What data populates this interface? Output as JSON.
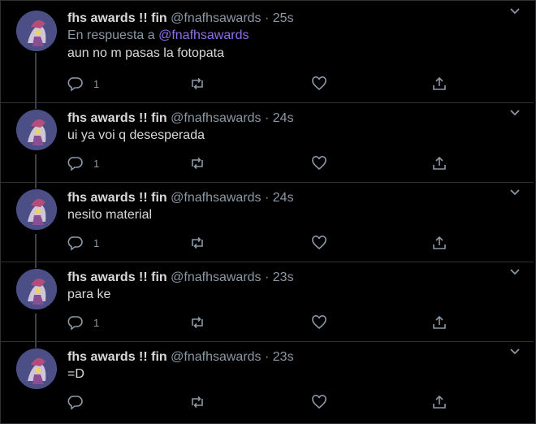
{
  "colors": {
    "background": "#000000",
    "text": "#d9d9d9",
    "muted": "#8b98a5",
    "mention": "#8d6fe8",
    "avatar": "#4b4f86"
  },
  "tweets": [
    {
      "name": "fhs awards !! fin",
      "handle": "@fnafhsawards",
      "dot": "·",
      "time": "25s",
      "reply_prefix": "En respuesta a",
      "reply_mention": "@fnafhsawards",
      "text": "aun no m pasas la fotopata",
      "reply_count": "1"
    },
    {
      "name": "fhs awards !! fin",
      "handle": "@fnafhsawards",
      "dot": "·",
      "time": "24s",
      "text": "ui ya voi q desesperada",
      "reply_count": "1"
    },
    {
      "name": "fhs awards !! fin",
      "handle": "@fnafhsawards",
      "dot": "·",
      "time": "24s",
      "text": "nesito material",
      "reply_count": "1"
    },
    {
      "name": "fhs awards !! fin",
      "handle": "@fnafhsawards",
      "dot": "·",
      "time": "23s",
      "text": "para ke",
      "reply_count": "1"
    },
    {
      "name": "fhs awards !! fin",
      "handle": "@fnafhsawards",
      "dot": "·",
      "time": "23s",
      "text": "=D",
      "reply_count": ""
    }
  ]
}
